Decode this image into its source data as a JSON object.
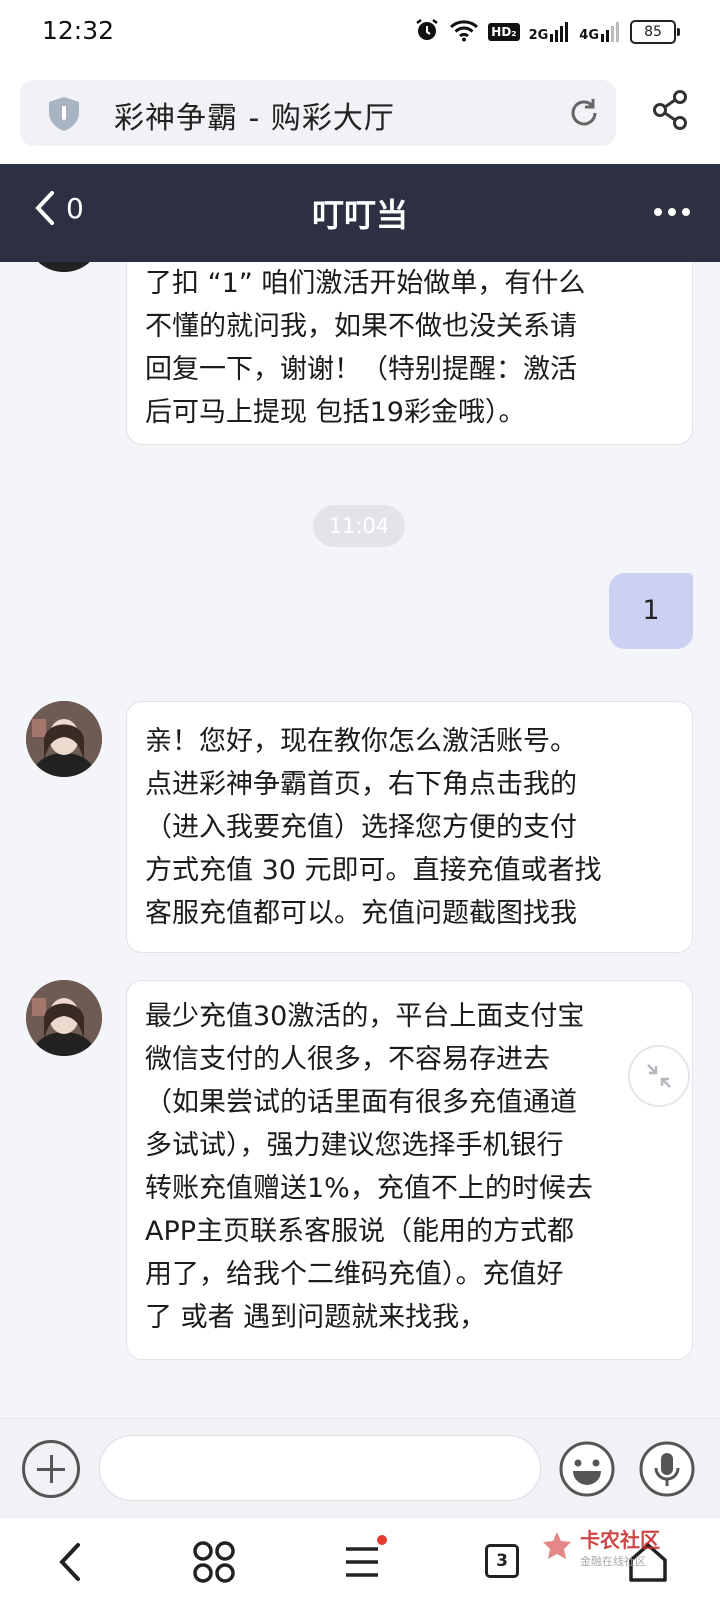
{
  "status_bar": {
    "time": "12:32",
    "battery": "85",
    "network_1": "2G",
    "network_2": "4G",
    "hd_badge": "HD₂"
  },
  "browser": {
    "page_title": "彩神争霸 - 购彩大厅"
  },
  "chat_header": {
    "back_count": "0",
    "title": "叮叮当"
  },
  "messages": {
    "m1": {
      "lines": [
        "了扣 “1” 咱们激活开始做单，有什么",
        "不懂的就问我，如果不做也没关系请",
        "回复一下，谢谢！（特别提醒：激活",
        "后可马上提现 包括19彩金哦）。"
      ]
    },
    "timestamp": "11:04",
    "m2": {
      "text": "1"
    },
    "m3": {
      "lines": [
        "亲！您好，现在教你怎么激活账号。",
        "点进彩神争霸首页，右下角点击我的",
        "（进入我要充值）选择您方便的支付",
        "方式充值 30 元即可。直接充值或者找",
        "客服充值都可以。充值问题截图找我"
      ]
    },
    "m4": {
      "lines": [
        "最少充值30激活的，平台上面支付宝",
        "微信支付的人很多，不容易存进去",
        "（如果尝试的话里面有很多充值通道",
        "多试试），强力建议您选择手机银行",
        "转账充值赠送1%，充值不上的时候去",
        "APP主页联系客服说（能用的方式都",
        "用了，给我个二维码充值）。充值好",
        "了 或者 遇到问题就来找我，"
      ]
    }
  },
  "input": {
    "value": "",
    "placeholder": ""
  },
  "navbar": {
    "tab_count": "3"
  },
  "watermark": {
    "title": "卡农社区",
    "subtitle": "金融在线社区"
  },
  "colors": {
    "header_bg": "#2c3042",
    "my_bubble": "#cdd1f1",
    "page_bg": "#f4f5f8"
  }
}
